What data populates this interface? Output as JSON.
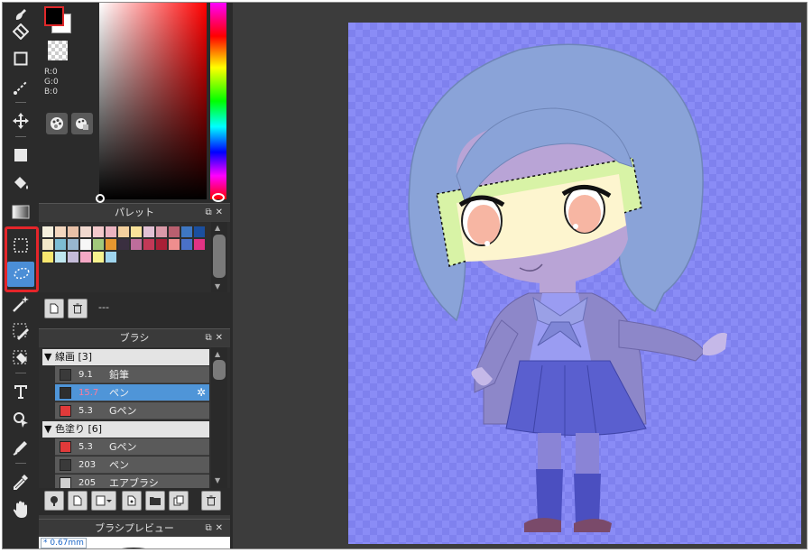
{
  "color": {
    "rgb": {
      "r": "R:0",
      "g": "G:0",
      "b": "B:0"
    },
    "foreground": "#000000",
    "background": "#ffffff"
  },
  "palette": {
    "title": "パレット",
    "swatches": [
      "#f5efdd",
      "#f3d7bf",
      "#e7c0a7",
      "#f1d9cf",
      "#f3c9cb",
      "#ecb4c1",
      "#f4d09e",
      "#f9e29a",
      "#e2c1d4",
      "#db9aa9",
      "#b95f6f",
      "#3e77c3",
      "#1b4f9f",
      "#f3e9c9",
      "#7dbdd3",
      "#98b7cf",
      "#f7f7f7",
      "#a2c97c",
      "#e79630",
      "#3a2f40",
      "#be6d9b",
      "#c23957",
      "#a92036",
      "#ef8e8e",
      "#4a71c8",
      "#e23385",
      "#f8e76f",
      "#bfe6ef",
      "#c4bcd9",
      "#f5a8c5",
      "#f7f28e",
      "#9fd5ee"
    ],
    "footer_text": "---"
  },
  "brush": {
    "title": "ブラシ",
    "groups": [
      {
        "label": "線画 [3]"
      },
      {
        "label": "色塗り [6]"
      }
    ],
    "items": [
      {
        "size": "9.1",
        "name": "鉛筆",
        "color": "#3a3a3a"
      },
      {
        "size": "15.7",
        "name": "ペン",
        "color": "#2e2e2e"
      },
      {
        "size": "5.3",
        "name": "Gペン",
        "color": "#e03a3a"
      },
      {
        "size": "5.3",
        "name": "Gペン",
        "color": "#e03a3a"
      },
      {
        "size": "203",
        "name": "ペン",
        "color": "#3a3a3a"
      },
      {
        "size": "205",
        "name": "エアブラシ",
        "color": "#cfcfcf"
      }
    ]
  },
  "preview": {
    "title": "ブラシプレビュー",
    "size_label": "* 0.67mm"
  },
  "canvas": {
    "background_color": "#8a8cf6",
    "hair_color": "#8aa3d8",
    "skin_color": "#fdf5cf",
    "selection_color": "#d8f3a6"
  }
}
